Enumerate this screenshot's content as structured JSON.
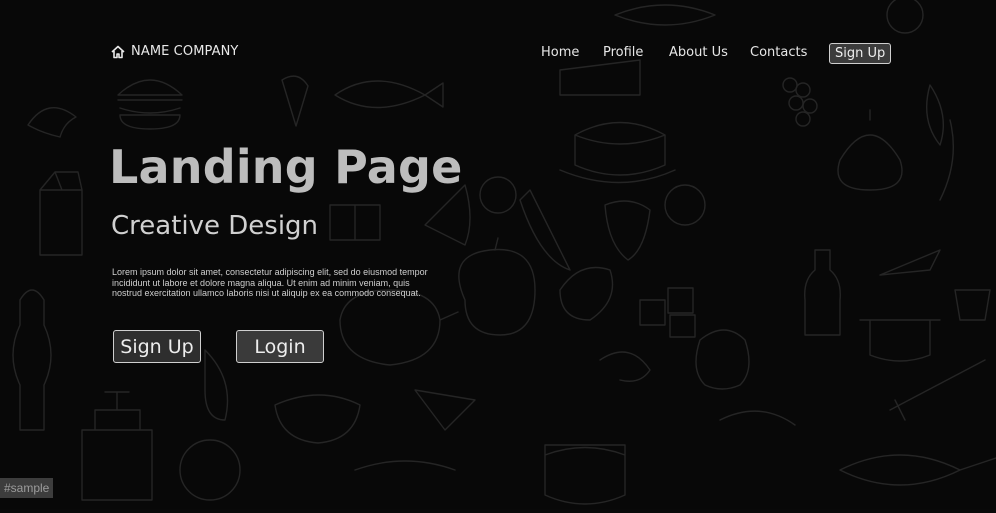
{
  "brand": {
    "name": "NAME COMPANY",
    "icon": "home-icon"
  },
  "nav": {
    "items": [
      "Home",
      "Profile",
      "About Us",
      "Contacts"
    ],
    "signup_label": "Sign Up"
  },
  "hero": {
    "title": "Landing Page",
    "subtitle": "Creative Design",
    "text": "Lorem ipsum dolor sit amet, consectetur adipiscing elit, sed do eiusmod tempor incididunt ut labore et dolore magna aliqua. Ut enim ad minim veniam, quis nostrud exercitation ullamco laboris nisi ut aliquip ex ea commodo consequat."
  },
  "actions": {
    "signup_label": "Sign Up",
    "login_label": "Login"
  },
  "watermark": "#sample",
  "colors": {
    "background": "#0a0a0a",
    "doodle": "#2b2b2b",
    "title": "#bdbdbd",
    "button_bg": "#2e2e2e",
    "button_border": "#cfcfcf"
  }
}
